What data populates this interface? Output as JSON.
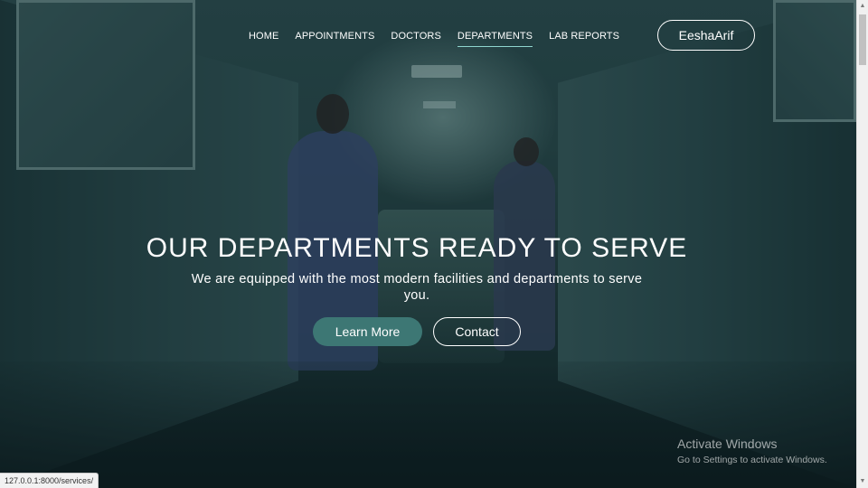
{
  "nav": {
    "items": [
      {
        "label": "HOME",
        "active": false
      },
      {
        "label": "APPOINTMENTS",
        "active": false
      },
      {
        "label": "DOCTORS",
        "active": false
      },
      {
        "label": "DEPARTMENTS",
        "active": true
      },
      {
        "label": "LAB REPORTS",
        "active": false
      }
    ],
    "user_label": "EeshaArif"
  },
  "hero": {
    "title": "OUR DEPARTMENTS READY TO SERVE",
    "subtitle": "We are equipped with the most modern facilities and departments to serve you.",
    "primary_button": "Learn More",
    "secondary_button": "Contact"
  },
  "watermark": {
    "title": "Activate Windows",
    "subtitle": "Go to Settings to activate Windows."
  },
  "status_bar": {
    "url": "127.0.0.1:8000/services/"
  },
  "colors": {
    "accent": "#3d7774",
    "nav_underline": "#8fd6cf",
    "overlay": "#0e2226"
  },
  "icons": {
    "scroll_up": "chevron-up-icon",
    "scroll_down": "chevron-down-icon"
  }
}
